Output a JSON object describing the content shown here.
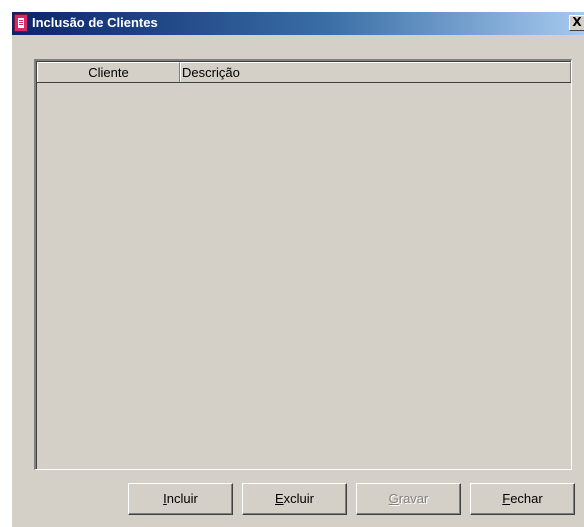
{
  "window": {
    "title": "Inclusão de Clientes",
    "icon": "document-icon",
    "close_label": "X"
  },
  "grid": {
    "columns": [
      "Cliente",
      "Descrição"
    ],
    "rows": []
  },
  "buttons": {
    "incluir": {
      "mnemonic": "I",
      "rest": "ncluir",
      "enabled": true
    },
    "excluir": {
      "mnemonic": "E",
      "rest": "xcluir",
      "enabled": true
    },
    "gravar": {
      "mnemonic": "G",
      "rest": "ravar",
      "enabled": false
    },
    "fechar": {
      "mnemonic": "F",
      "rest": "echar",
      "enabled": true
    }
  },
  "colors": {
    "window_face": "#d4d0c8",
    "title_gradient_start": "#0a246a",
    "title_gradient_end": "#a6caf0",
    "icon_accent": "#d62a6a"
  }
}
